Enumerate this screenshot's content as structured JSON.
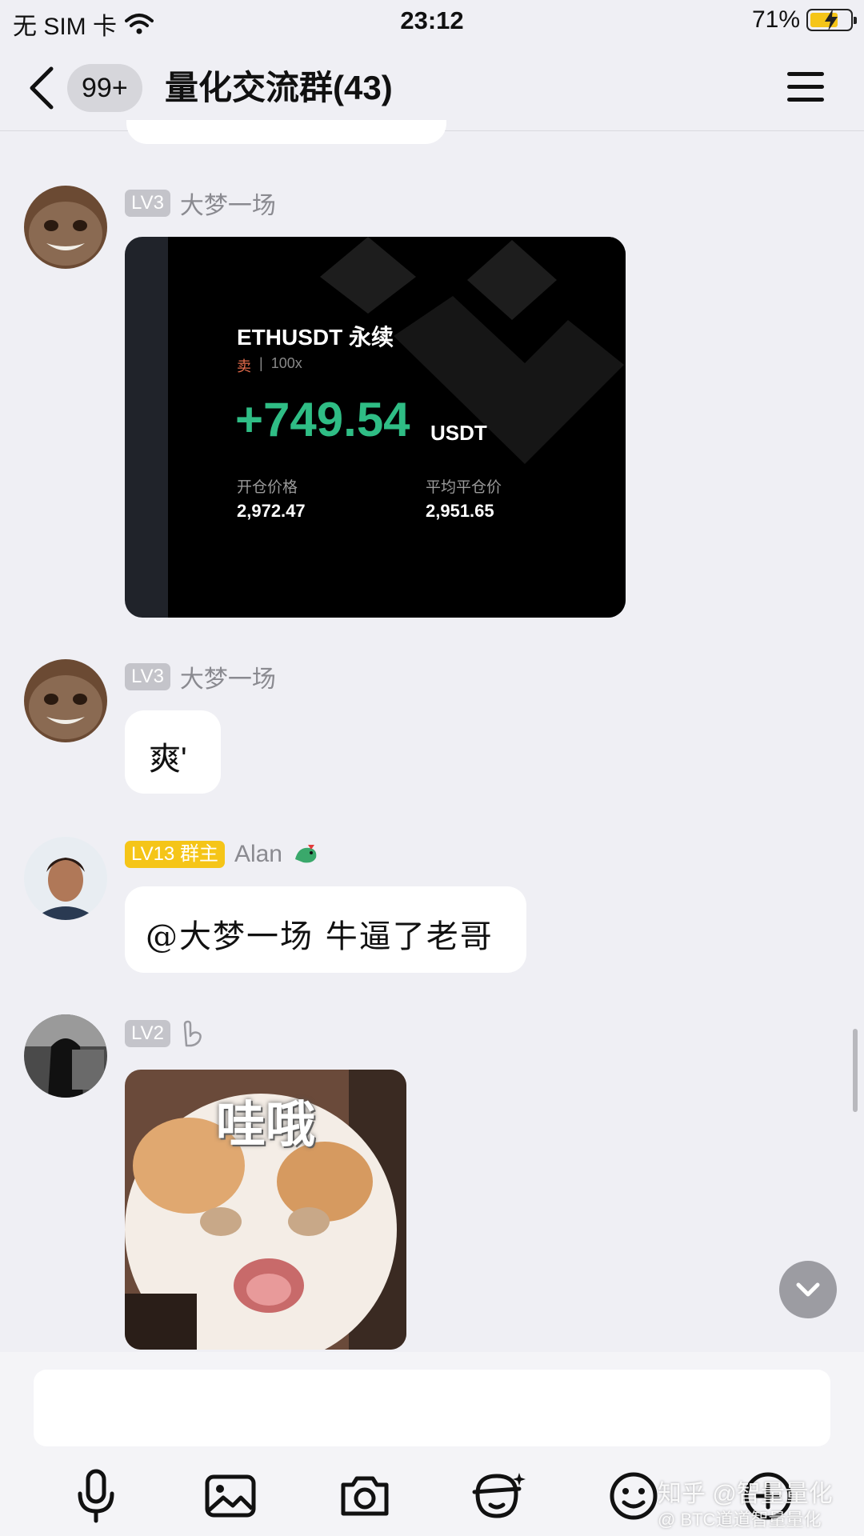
{
  "status_bar": {
    "carrier": "无 SIM 卡",
    "time": "23:12",
    "battery": "71%",
    "battery_level": 0.71
  },
  "nav": {
    "unread_count": "99+",
    "title": "量化交流群(43)"
  },
  "messages": [
    {
      "level": "LV3",
      "sender": "大梦一场",
      "type": "trade-card",
      "card": {
        "pair": "ETHUSDT 永续",
        "side": "卖",
        "leverage": "100x",
        "pnl": "+749.54",
        "unit": "USDT",
        "open_label": "开仓价格",
        "open_value": "2,972.47",
        "close_label": "平均平仓价",
        "close_value": "2,951.65"
      }
    },
    {
      "level": "LV3",
      "sender": "大梦一场",
      "type": "text",
      "text": "爽'"
    },
    {
      "level": "LV13 群主",
      "sender": "Alan",
      "type": "text",
      "text": "@大梦一场 牛逼了老哥"
    },
    {
      "level": "LV2",
      "sender": "",
      "type": "sticker",
      "caption": "哇哦"
    }
  ],
  "input": {
    "placeholder": ""
  },
  "toolbar": [
    "mic-icon",
    "image-icon",
    "camera-icon",
    "sticker-face-icon",
    "emoji-icon",
    "more-icon"
  ],
  "watermark": {
    "line1": "知乎 @智量量化",
    "line2": "@ BTC道道智量量化"
  },
  "colors": {
    "background": "#efeff4",
    "owner_badge": "#f5c518",
    "pnl_green": "#2fbd85",
    "sell_red": "#e36b4b"
  }
}
